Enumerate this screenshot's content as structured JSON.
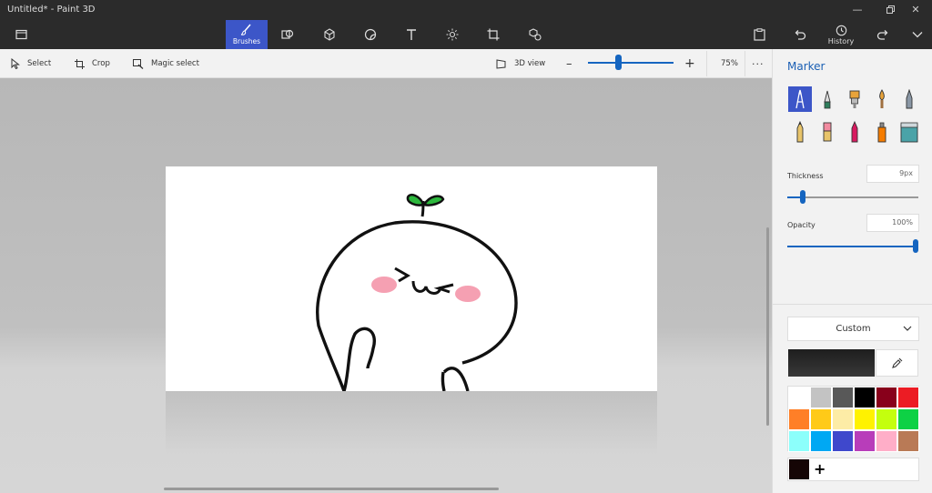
{
  "window": {
    "title": "Untitled* - Paint 3D"
  },
  "top_tabs": {
    "brushes_label": "Brushes",
    "history_label": "History"
  },
  "toolbar": {
    "select_label": "Select",
    "crop_label": "Crop",
    "magic_select_label": "Magic select",
    "view3d_label": "3D view",
    "zoom_value": "75%",
    "zoom_level": 0.35
  },
  "panel": {
    "title": "Marker",
    "thickness_label": "Thickness",
    "thickness_value": "9px",
    "thickness_level": 0.1,
    "opacity_label": "Opacity",
    "opacity_value": "100%",
    "opacity_level": 1.0,
    "color_mode": "Custom",
    "current_color": "#1e1e1e",
    "palette": [
      "#ffffff",
      "#c3c3c3",
      "#585858",
      "#000000",
      "#88001b",
      "#ec1c24",
      "#ff7f27",
      "#ffca18",
      "#fdeca6",
      "#fff200",
      "#c4ff0e",
      "#0ed145",
      "#8cfffb",
      "#00a8f3",
      "#3f48cc",
      "#b83dba",
      "#ffaec8",
      "#b97a56"
    ],
    "custom_color": "#150505",
    "add_color_label": "+"
  }
}
